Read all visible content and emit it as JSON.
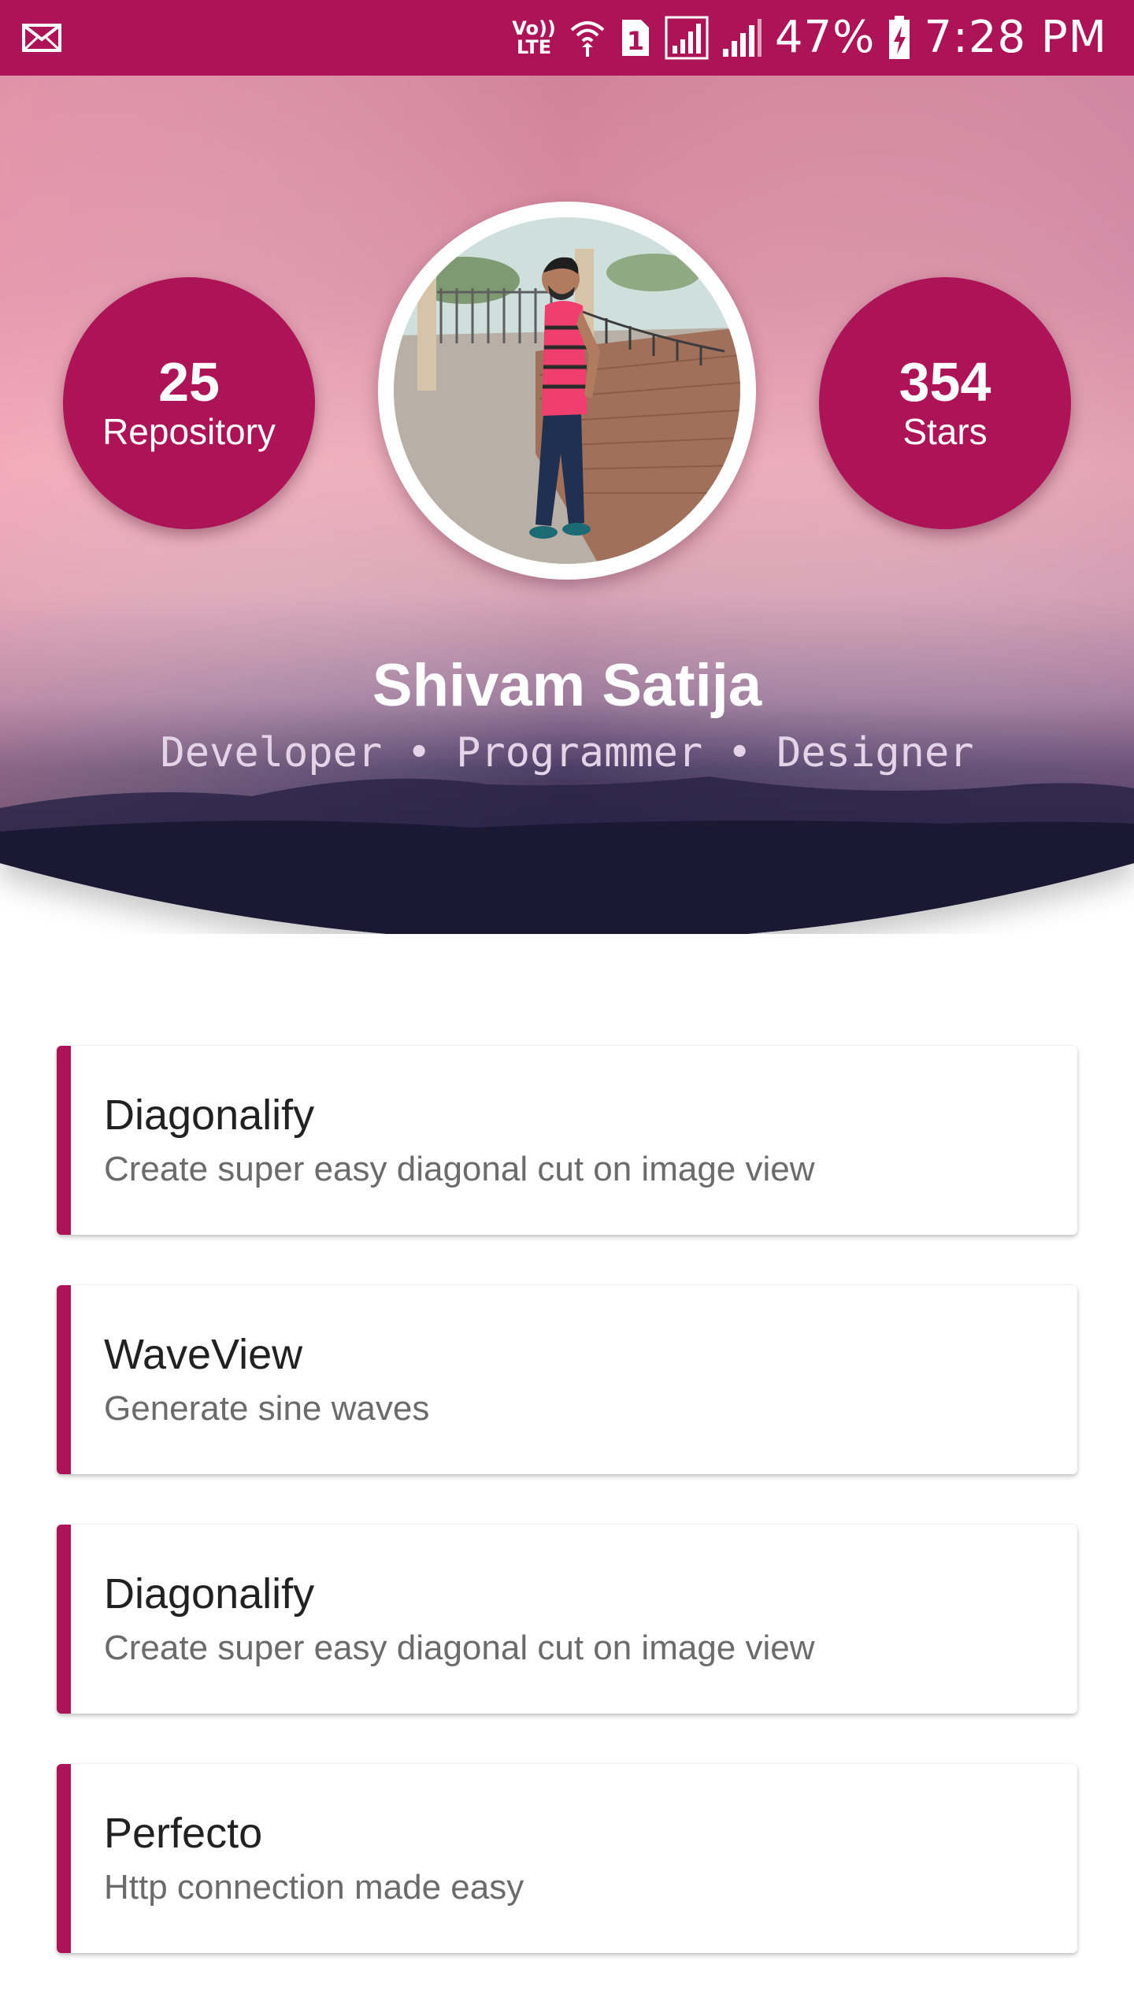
{
  "status_bar": {
    "network_label_top": "Vo))",
    "network_label_bottom": "LTE",
    "sim_label": "1",
    "battery_percent": "47%",
    "time": "7:28 PM",
    "icons": [
      "mail-icon",
      "wifi-calling-icon",
      "sim-icon",
      "signal-icon",
      "signal-icon",
      "battery-charging-icon"
    ]
  },
  "profile": {
    "name": "Shivam Satija",
    "tagline": "Developer • Programmer • Designer",
    "stats": {
      "repositories": {
        "value": "25",
        "label": "Repository"
      },
      "stars": {
        "value": "354",
        "label": "Stars"
      }
    }
  },
  "repos": [
    {
      "title": "Diagonalify",
      "description": "Create super easy diagonal cut on image view"
    },
    {
      "title": "WaveView",
      "description": "Generate sine waves"
    },
    {
      "title": "Diagonalify",
      "description": "Create super easy diagonal cut on image view"
    },
    {
      "title": "Perfecto",
      "description": "Http connection made easy"
    }
  ],
  "colors": {
    "accent": "#ad1457",
    "header_dark": "#1e1a3c",
    "card_title": "#212121",
    "card_subtitle": "#6b6b6b"
  }
}
